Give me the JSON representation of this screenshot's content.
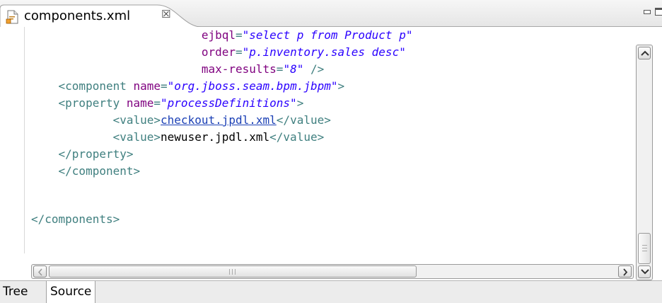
{
  "editor_tab": {
    "title": "components.xml",
    "close_glyph": "☒",
    "icon": "xml-file-icon"
  },
  "view_controls": {
    "minimize_icon": "minimize-icon",
    "maximize_icon": "maximize-icon"
  },
  "code": {
    "lines": [
      {
        "indent": "                         ",
        "parts": [
          [
            "attr",
            "ejbql"
          ],
          [
            "tag",
            "="
          ],
          [
            "val",
            "\"select p from Product p\""
          ]
        ]
      },
      {
        "indent": "                         ",
        "parts": [
          [
            "attr",
            "order"
          ],
          [
            "tag",
            "="
          ],
          [
            "val",
            "\"p.inventory.sales desc\""
          ]
        ]
      },
      {
        "indent": "                         ",
        "parts": [
          [
            "attr",
            "max-results"
          ],
          [
            "tag",
            "="
          ],
          [
            "val",
            "\"8\""
          ],
          [
            "tag",
            " />"
          ]
        ]
      },
      {
        "indent": "    ",
        "parts": [
          [
            "tag",
            "<component "
          ],
          [
            "attr",
            "name"
          ],
          [
            "tag",
            "="
          ],
          [
            "val",
            "\"org.jboss.seam.bpm.jbpm\""
          ],
          [
            "tag",
            ">"
          ]
        ]
      },
      {
        "indent": "    ",
        "parts": [
          [
            "tag",
            "<property "
          ],
          [
            "attr",
            "name"
          ],
          [
            "tag",
            "="
          ],
          [
            "val",
            "\"processDefinitions\""
          ],
          [
            "tag",
            ">"
          ]
        ]
      },
      {
        "indent": "            ",
        "parts": [
          [
            "tag",
            "<value>"
          ],
          [
            "link",
            "checkout.jpdl.xml"
          ],
          [
            "tag",
            "</value>"
          ]
        ]
      },
      {
        "indent": "            ",
        "parts": [
          [
            "tag",
            "<value>"
          ],
          [
            "text",
            "newuser.jpdl.xml"
          ],
          [
            "tag",
            "</value>"
          ]
        ]
      },
      {
        "indent": "    ",
        "parts": [
          [
            "tag",
            "</property>"
          ]
        ]
      },
      {
        "indent": "    ",
        "parts": [
          [
            "tag",
            "</component>"
          ]
        ]
      },
      {
        "indent": "",
        "parts": []
      },
      {
        "indent": "",
        "parts": [
          [
            "tag",
            "</components>"
          ]
        ]
      }
    ]
  },
  "scrollbars": {
    "vertical_position": 0.92,
    "horizontal_position": 0.0
  },
  "bottom_tabs": {
    "tree_label": "Tree",
    "source_label": "Source",
    "active": "Source"
  },
  "colors": {
    "tag": "#3f7f7f",
    "attribute": "#7f007f",
    "value": "#2a00ff",
    "link": "#1a3fb5"
  }
}
